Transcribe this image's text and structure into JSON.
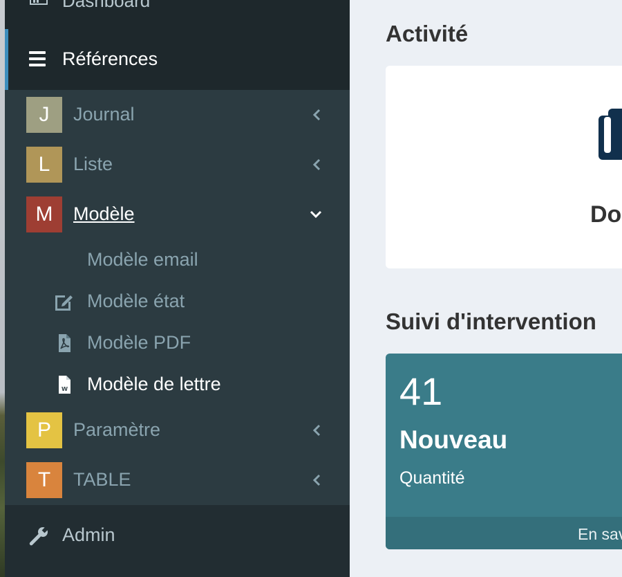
{
  "sidebar": {
    "top_item": {
      "label": "Dashboard",
      "icon": "dashboard-icon"
    },
    "section": {
      "label": "Références",
      "icon": "bars-icon"
    },
    "items": [
      {
        "letter": "J",
        "label": "Journal",
        "color": "#9e9f82"
      },
      {
        "letter": "L",
        "label": "Liste",
        "color": "#b09658"
      },
      {
        "letter": "M",
        "label": "Modèle",
        "color": "#9e3e33"
      },
      {
        "letter": "P",
        "label": "Paramètre",
        "color": "#e4c343"
      },
      {
        "letter": "T",
        "label": "TABLE",
        "color": "#d9843d"
      }
    ],
    "submenu": [
      {
        "label": "Modèle email",
        "icon": "none"
      },
      {
        "label": "Modèle état",
        "icon": "edit-icon"
      },
      {
        "label": "Modèle PDF",
        "icon": "file-pdf-icon"
      },
      {
        "label": "Modèle de lettre",
        "icon": "file-word-icon"
      }
    ],
    "admin": {
      "label": "Admin",
      "icon": "wrench-icon"
    }
  },
  "main": {
    "activity_title": "Activité",
    "activity_card": {
      "partial_text": "Do",
      "icon": "copy-icon"
    },
    "tracking_title": "Suivi d'intervention",
    "stat_box": {
      "value": "41",
      "title": "Nouveau",
      "subtitle": "Quantité",
      "footer": "En sav"
    }
  },
  "colors": {
    "sidebar_bg": "#222d32",
    "tree_bg": "#2c3b41",
    "accent": "#3c8dbc",
    "stat_bg": "#3a7c89"
  }
}
